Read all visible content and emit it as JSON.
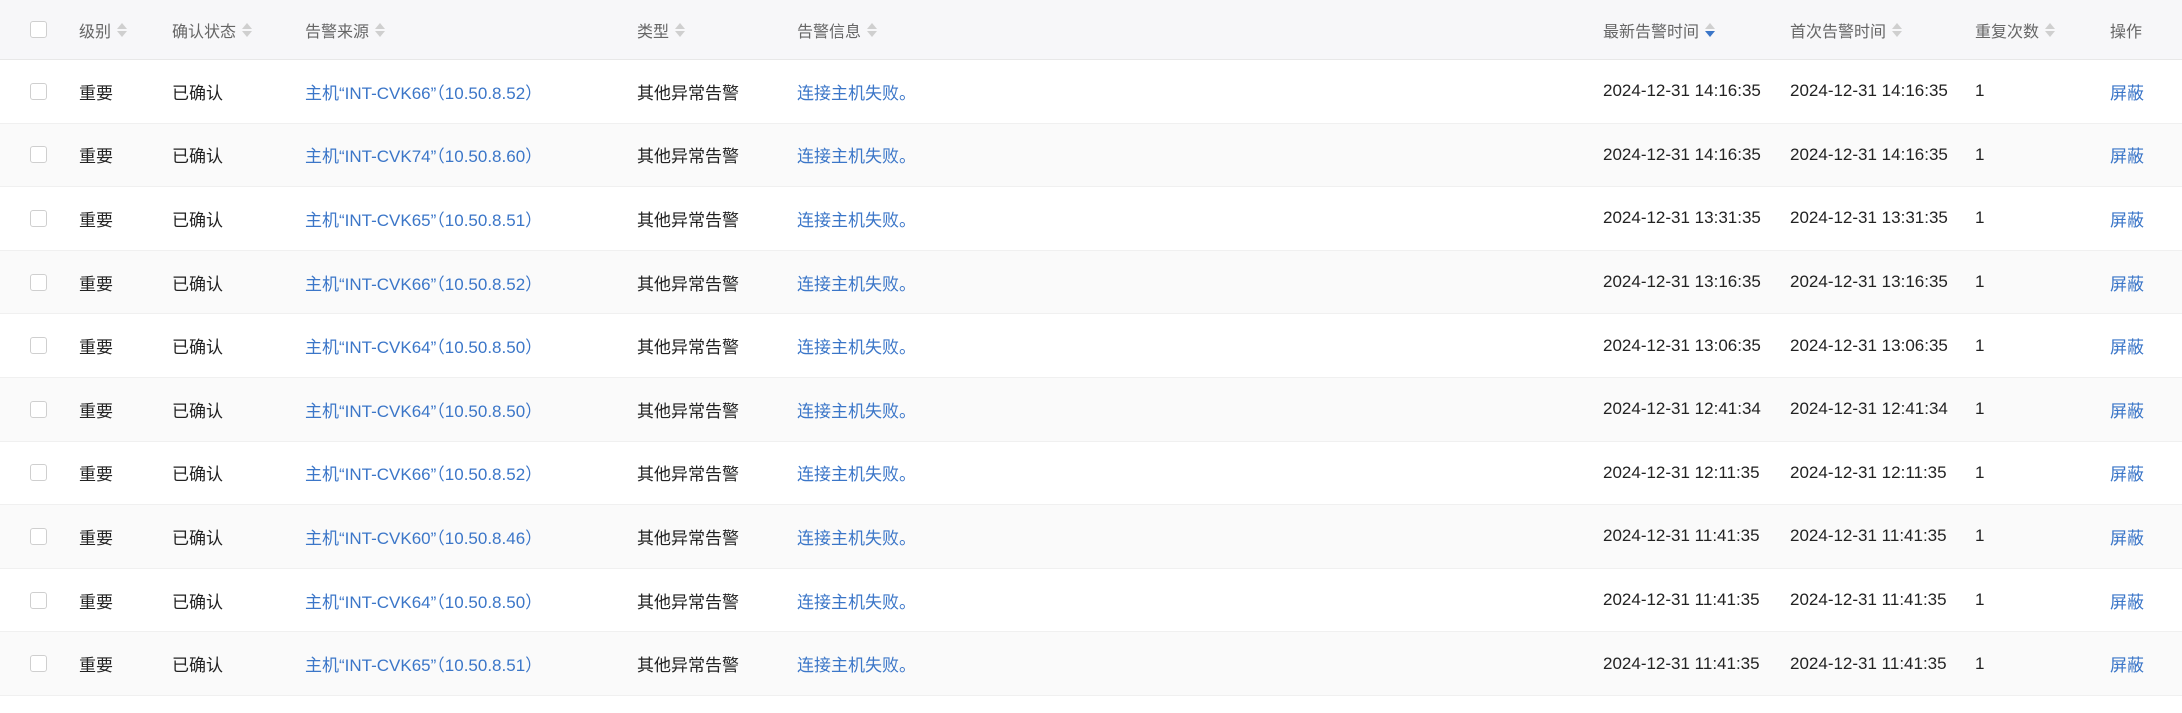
{
  "header": {
    "level": "级别",
    "ack_status": "确认状态",
    "source": "告警来源",
    "type": "类型",
    "info": "告警信息",
    "latest_time": "最新告警时间",
    "first_time": "首次告警时间",
    "repeat_count": "重复次数",
    "action": "操作"
  },
  "rows": [
    {
      "level": "重要",
      "ack": "已确认",
      "source": "主机“INT-CVK66”（10.50.8.52）",
      "type": "其他异常告警",
      "info": "连接主机失败。",
      "latest": "2024-12-31 14:16:35",
      "first": "2024-12-31 14:16:35",
      "repeat": "1",
      "action": "屏蔽"
    },
    {
      "level": "重要",
      "ack": "已确认",
      "source": "主机“INT-CVK74”（10.50.8.60）",
      "type": "其他异常告警",
      "info": "连接主机失败。",
      "latest": "2024-12-31 14:16:35",
      "first": "2024-12-31 14:16:35",
      "repeat": "1",
      "action": "屏蔽"
    },
    {
      "level": "重要",
      "ack": "已确认",
      "source": "主机“INT-CVK65”（10.50.8.51）",
      "type": "其他异常告警",
      "info": "连接主机失败。",
      "latest": "2024-12-31 13:31:35",
      "first": "2024-12-31 13:31:35",
      "repeat": "1",
      "action": "屏蔽"
    },
    {
      "level": "重要",
      "ack": "已确认",
      "source": "主机“INT-CVK66”（10.50.8.52）",
      "type": "其他异常告警",
      "info": "连接主机失败。",
      "latest": "2024-12-31 13:16:35",
      "first": "2024-12-31 13:16:35",
      "repeat": "1",
      "action": "屏蔽"
    },
    {
      "level": "重要",
      "ack": "已确认",
      "source": "主机“INT-CVK64”（10.50.8.50）",
      "type": "其他异常告警",
      "info": "连接主机失败。",
      "latest": "2024-12-31 13:06:35",
      "first": "2024-12-31 13:06:35",
      "repeat": "1",
      "action": "屏蔽"
    },
    {
      "level": "重要",
      "ack": "已确认",
      "source": "主机“INT-CVK64”（10.50.8.50）",
      "type": "其他异常告警",
      "info": "连接主机失败。",
      "latest": "2024-12-31 12:41:34",
      "first": "2024-12-31 12:41:34",
      "repeat": "1",
      "action": "屏蔽"
    },
    {
      "level": "重要",
      "ack": "已确认",
      "source": "主机“INT-CVK66”（10.50.8.52）",
      "type": "其他异常告警",
      "info": "连接主机失败。",
      "latest": "2024-12-31 12:11:35",
      "first": "2024-12-31 12:11:35",
      "repeat": "1",
      "action": "屏蔽"
    },
    {
      "level": "重要",
      "ack": "已确认",
      "source": "主机“INT-CVK60”（10.50.8.46）",
      "type": "其他异常告警",
      "info": "连接主机失败。",
      "latest": "2024-12-31 11:41:35",
      "first": "2024-12-31 11:41:35",
      "repeat": "1",
      "action": "屏蔽"
    },
    {
      "level": "重要",
      "ack": "已确认",
      "source": "主机“INT-CVK64”（10.50.8.50）",
      "type": "其他异常告警",
      "info": "连接主机失败。",
      "latest": "2024-12-31 11:41:35",
      "first": "2024-12-31 11:41:35",
      "repeat": "1",
      "action": "屏蔽"
    },
    {
      "level": "重要",
      "ack": "已确认",
      "source": "主机“INT-CVK65”（10.50.8.51）",
      "type": "其他异常告警",
      "info": "连接主机失败。",
      "latest": "2024-12-31 11:41:35",
      "first": "2024-12-31 11:41:35",
      "repeat": "1",
      "action": "屏蔽"
    }
  ],
  "colors": {
    "link": "#3b76c8",
    "header_bg": "#f7f7f9"
  }
}
